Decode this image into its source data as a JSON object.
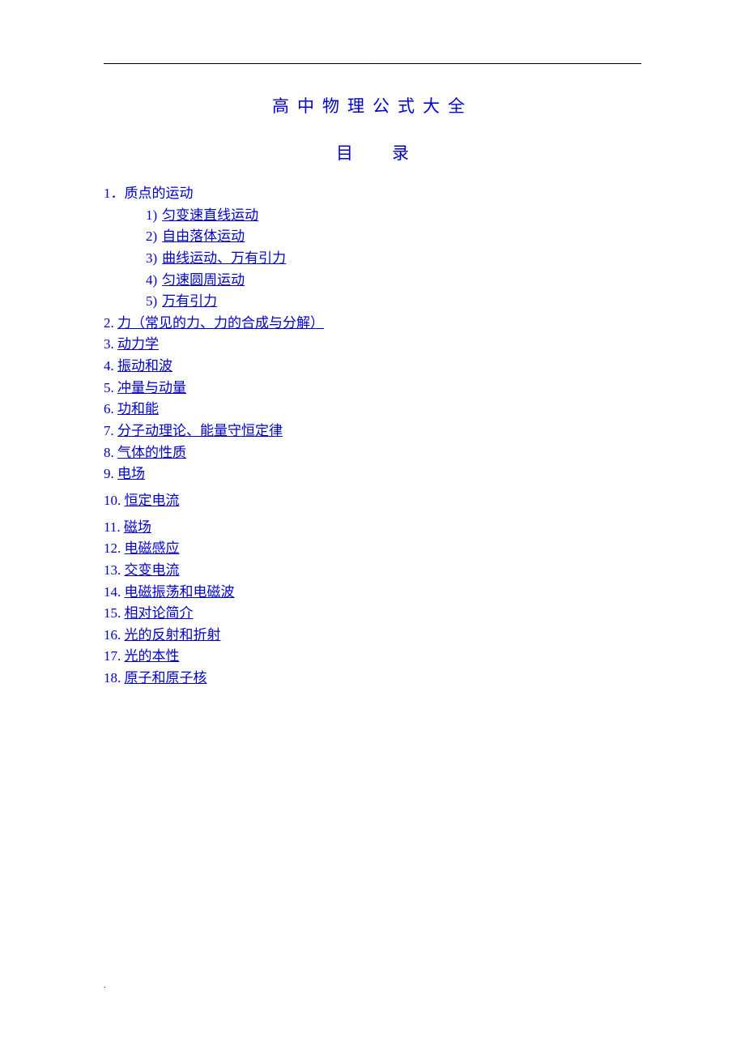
{
  "title": "高中物理公式大全",
  "subtitle_left": "目",
  "subtitle_right": "录",
  "section1": {
    "num": "1．",
    "label": "质点的运动",
    "subs": [
      {
        "num": "1)",
        "label": "匀变速直线运动"
      },
      {
        "num": "2)",
        "label": "自由落体运动"
      },
      {
        "num": "3)",
        "label": "曲线运动、万有引力"
      },
      {
        "num": "4)",
        "label": "匀速圆周运动"
      },
      {
        "num": "5)",
        "label": "万有引力"
      }
    ]
  },
  "sections": [
    {
      "num": "2.",
      "label": "力（常见的力、力的合成与分解）"
    },
    {
      "num": "3.",
      "label": "动力学"
    },
    {
      "num": "4.",
      "label": "振动和波"
    },
    {
      "num": "5.",
      "label": "冲量与动量"
    },
    {
      "num": "6.",
      "label": "功和能"
    },
    {
      "num": "7.",
      "label": "分子动理论、能量守恒定律"
    },
    {
      "num": "8.",
      "label": "气体的性质"
    },
    {
      "num": "9.",
      "label": "电场"
    },
    {
      "num": "10.",
      "label": "恒定电流"
    },
    {
      "num": "11.",
      "label": "磁场"
    },
    {
      "num": "12.",
      "label": "电磁感应"
    },
    {
      "num": "13.",
      "label": "交变电流"
    },
    {
      "num": "14.",
      "label": "电磁振荡和电磁波"
    },
    {
      "num": "15.",
      "label": "相对论简介"
    },
    {
      "num": "16.",
      "label": "光的反射和折射"
    },
    {
      "num": "17.",
      "label": "光的本性"
    },
    {
      "num": "18.",
      "label": "原子和原子核"
    }
  ]
}
